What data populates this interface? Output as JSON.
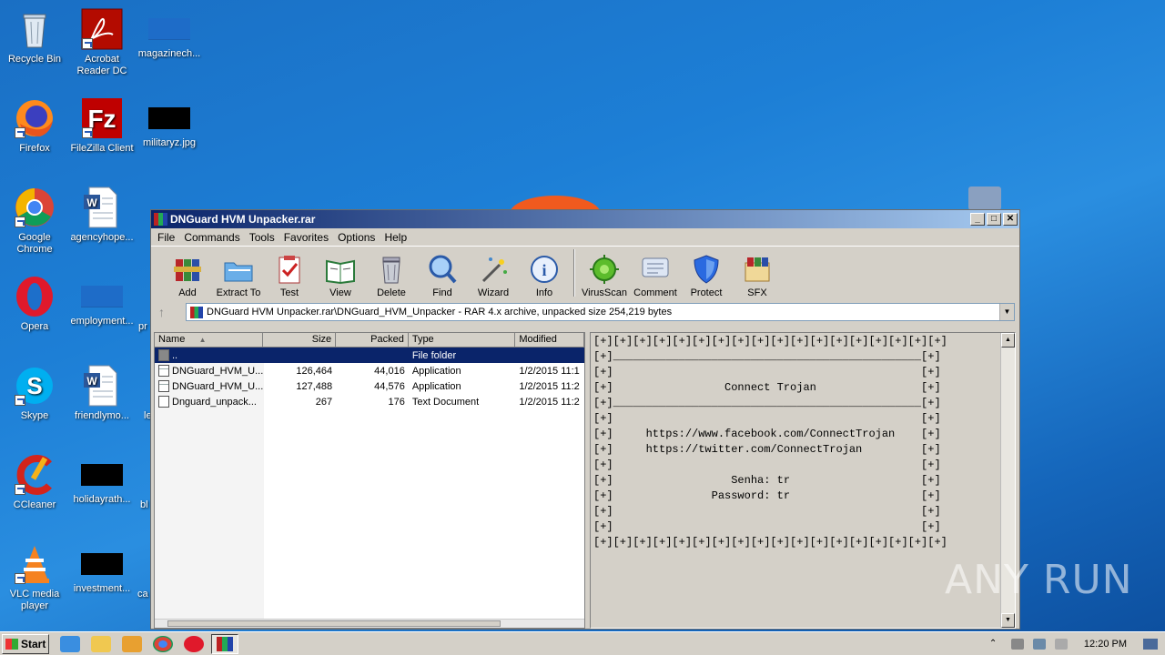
{
  "desktop": {
    "icons": [
      {
        "label": "Recycle Bin"
      },
      {
        "label": "Acrobat Reader DC"
      },
      {
        "label": "magazinech..."
      },
      {
        "label": "Firefox"
      },
      {
        "label": "FileZilla Client"
      },
      {
        "label": "militaryz.jpg"
      },
      {
        "label": "Google Chrome"
      },
      {
        "label": "agencyhope..."
      },
      {
        "label": "Opera"
      },
      {
        "label": "employment..."
      },
      {
        "label": "Skype"
      },
      {
        "label": "friendlymo..."
      },
      {
        "label": "CCleaner"
      },
      {
        "label": "holidayrath..."
      },
      {
        "label": "VLC media player"
      },
      {
        "label": "investment..."
      }
    ],
    "partial_labels": [
      "pr",
      "le",
      "bl",
      "ca"
    ]
  },
  "window": {
    "title": "DNGuard HVM Unpacker.rar",
    "minimize_glyph": "_",
    "maximize_glyph": "□",
    "close_glyph": "✕",
    "menu": [
      "File",
      "Commands",
      "Tools",
      "Favorites",
      "Options",
      "Help"
    ],
    "toolbar": [
      "Add",
      "Extract To",
      "Test",
      "View",
      "Delete",
      "Find",
      "Wizard",
      "Info",
      "VirusScan",
      "Comment",
      "Protect",
      "SFX"
    ],
    "address": "DNGuard HVM Unpacker.rar\\DNGuard_HVM_Unpacker - RAR 4.x archive, unpacked size 254,219 bytes",
    "up_glyph": "↑",
    "dropdown_glyph": "▼"
  },
  "files": {
    "columns": {
      "name": "Name",
      "sort": "▲",
      "size": "Size",
      "packed": "Packed",
      "type": "Type",
      "modified": "Modified"
    },
    "rows": [
      {
        "name": "..",
        "size": "",
        "packed": "",
        "type": "File folder",
        "modified": "",
        "kind": "folder"
      },
      {
        "name": "DNGuard_HVM_U...",
        "size": "126,464",
        "packed": "44,016",
        "type": "Application",
        "modified": "1/2/2015 11:1",
        "kind": "app"
      },
      {
        "name": "DNGuard_HVM_U...",
        "size": "127,488",
        "packed": "44,576",
        "type": "Application",
        "modified": "1/2/2015 11:2",
        "kind": "app"
      },
      {
        "name": "Dnguard_unpack...",
        "size": "267",
        "packed": "176",
        "type": "Text Document",
        "modified": "1/2/2015 11:2",
        "kind": "doc"
      }
    ]
  },
  "comment": {
    "lines": [
      "[+][+][+][+][+][+][+][+][+][+][+][+][+][+][+][+][+][+]",
      "[+]_______________________________________________[+]",
      "[+]                                               [+]",
      "[+]                 Connect Trojan                [+]",
      "[+]_______________________________________________[+]",
      "[+]                                               [+]",
      "[+]     https://www.facebook.com/ConnectTrojan    [+]",
      "[+]     https://twitter.com/ConnectTrojan         [+]",
      "[+]                                               [+]",
      "[+]                  Senha: tr                    [+]",
      "[+]               Password: tr                    [+]",
      "[+]                                               [+]",
      "[+]                                               [+]",
      "[+][+][+][+][+][+][+][+][+][+][+][+][+][+][+][+][+][+]"
    ]
  },
  "taskbar": {
    "start_label": "Start",
    "clock": "12:20 PM"
  },
  "watermark": "ANY RUN"
}
